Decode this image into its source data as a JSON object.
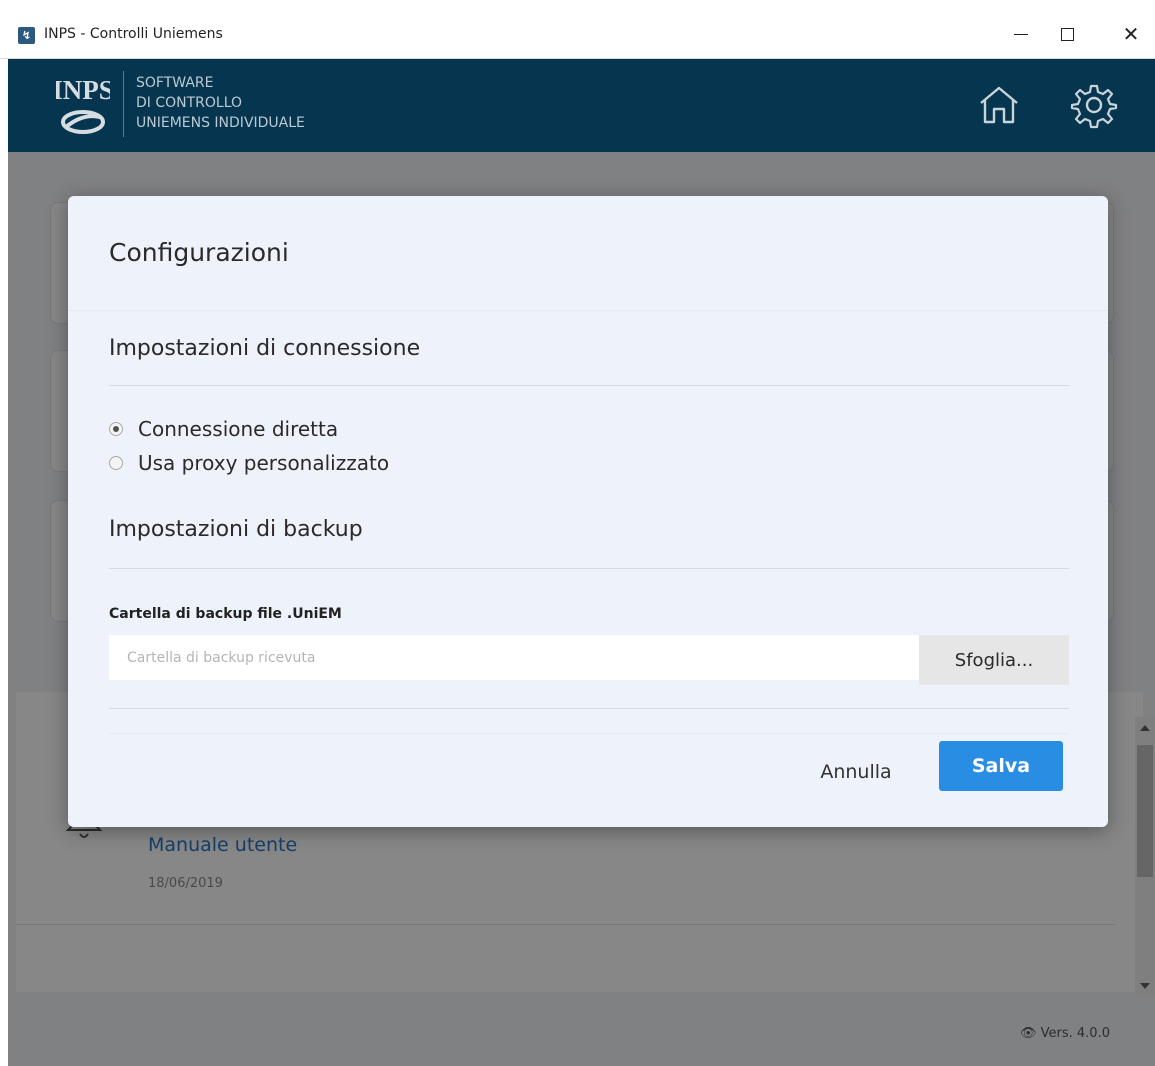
{
  "window": {
    "title": "INPS - Controlli Uniemens",
    "icon": "inps-app-icon",
    "controls": {
      "minimize": "minimize-icon",
      "maximize": "maximize-icon",
      "close": "close-icon"
    }
  },
  "header": {
    "logo_text": "INPS",
    "lines": [
      "SOFTWARE",
      "DI CONTROLLO",
      "UNIEMENS INDIVIDUALE"
    ],
    "icons": {
      "home": "home-icon",
      "settings": "gear-icon"
    },
    "colors": {
      "background": "#06364f",
      "text": "#bcc9d2"
    }
  },
  "background": {
    "news": {
      "link": "Manuale utente",
      "date": "18/06/2019",
      "icon": "bell-icon"
    },
    "version": "Vers. 4.0.0"
  },
  "modal": {
    "title": "Configurazioni",
    "connection": {
      "title": "Impostazioni di connessione",
      "options": [
        {
          "label": "Connessione diretta",
          "checked": true
        },
        {
          "label": "Usa proxy personalizzato",
          "checked": false
        }
      ]
    },
    "backup": {
      "title": "Impostazioni di backup",
      "field_label": "Cartella di backup file .UniEM",
      "placeholder": "Cartella di backup ricevuta",
      "value": "",
      "browse_label": "Sfoglia..."
    },
    "buttons": {
      "cancel": "Annulla",
      "save": "Salva"
    },
    "colors": {
      "save": "#2a8de4",
      "background": "#eef3fb"
    }
  }
}
